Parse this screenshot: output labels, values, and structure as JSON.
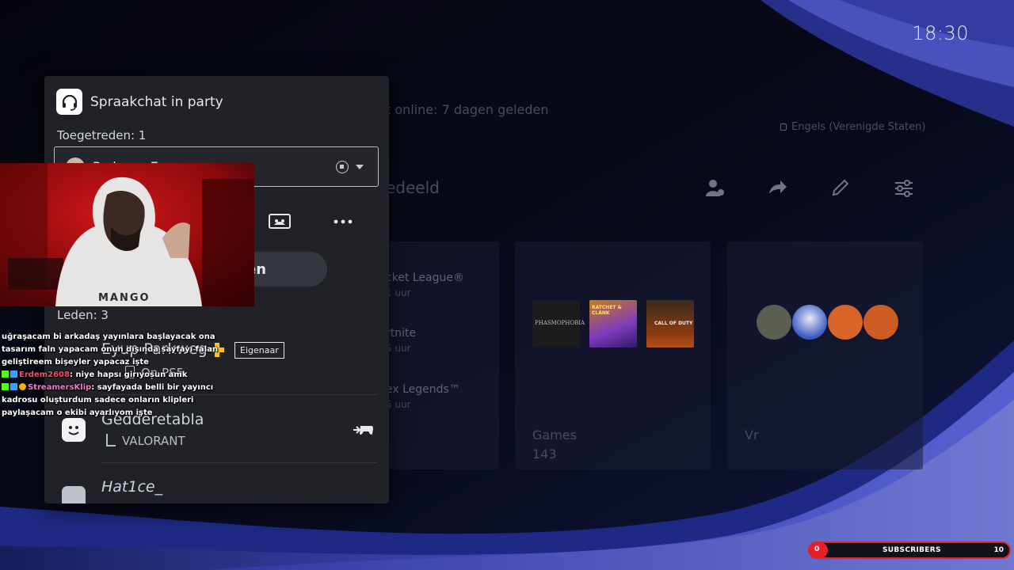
{
  "clock": "18:30",
  "background": {
    "last_online": "t online: 7 dagen geleden",
    "language": "Engels (Verenigde Staten)",
    "shared": "edeeld",
    "games": [
      {
        "title": "cket League®",
        "time": "1 uur"
      },
      {
        "title": "rtnite",
        "time": "5 uur"
      },
      {
        "title": "ex Legends™",
        "time": "5 uur"
      }
    ],
    "thumb_labels": [
      "PHASMOPHOBIA",
      "RATCHET & CLANK",
      "CALL OF DUTY"
    ],
    "card_games_label": "Games",
    "card_games_count": "143",
    "card_friends_label": "Vr"
  },
  "party": {
    "title": "Spraakchat in party",
    "joined_label": "Toegetreden: 1",
    "dropdown_value": "Parkweg Ey",
    "pill_label": "en",
    "members_label": "Leden: 3",
    "members": [
      {
        "name": "Eyup Parkweg",
        "sub": "Op PS5",
        "badge": "Eigenaar"
      },
      {
        "name": "Gedderetabla",
        "sub": "VALORANT"
      },
      {
        "name": "Hat1ce_",
        "sub": ""
      }
    ]
  },
  "cam": {
    "watermark": "MANGO"
  },
  "chat": {
    "lines": [
      {
        "user": "",
        "text": "uğraşacam bi arkadaş yayınlara başlayacak ona"
      },
      {
        "user": "",
        "text": "tasarım faln yapacam onun dışında sayfayı falan"
      },
      {
        "user": "",
        "text": "geliştireem bişeyler yapacaz işte"
      },
      {
        "user": "Erdem2608",
        "text": ": niye hapsı girıyosun amk"
      },
      {
        "user": "StreamersKlip",
        "text": ": sayfayada belli bir yayıncı"
      },
      {
        "user": "",
        "text": "kadrosu oluşturdum sadece onların klipleri"
      },
      {
        "user": "",
        "text": "paylaşacam o ekibi ayarlıyom işte"
      }
    ]
  },
  "subscribers": {
    "current": "0",
    "label": "SUBSCRIBERS",
    "goal": "10",
    "progress": 0.0
  },
  "colors": {
    "accent_blue": "#4b57d6",
    "sub_red": "#e6202a",
    "panel": "#202227"
  }
}
